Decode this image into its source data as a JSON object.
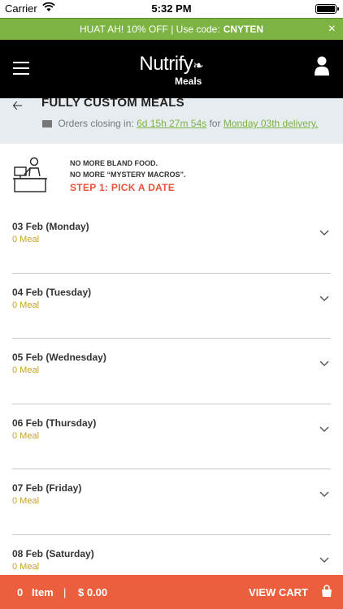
{
  "status_bar": {
    "carrier": "Carrier",
    "time": "5:32 PM"
  },
  "promo": {
    "text": "HUAT AH! 10% OFF | Use code:",
    "code": "CNYTEN",
    "close": "×"
  },
  "header": {
    "brand": "Nutrify",
    "sub": "Meals"
  },
  "page": {
    "title": "FULLY CUSTOM MEALS",
    "orders_prefix": "Orders closing in:",
    "countdown": "6d 15h 27m 54s",
    "for_text": "for",
    "delivery": "Monday 03th delivery."
  },
  "intro": {
    "line1": "NO MORE BLAND FOOD.",
    "line2": "NO MORE “MYSTERY MACROS”.",
    "step": "STEP 1: PICK A DATE"
  },
  "days": [
    {
      "name": "03 Feb (Monday)",
      "count": "0 Meal"
    },
    {
      "name": "04 Feb (Tuesday)",
      "count": "0 Meal"
    },
    {
      "name": "05 Feb (Wednesday)",
      "count": "0 Meal"
    },
    {
      "name": "06 Feb (Thursday)",
      "count": "0 Meal"
    },
    {
      "name": "07 Feb (Friday)",
      "count": "0 Meal"
    },
    {
      "name": "08 Feb (Saturday)",
      "count": "0 Meal"
    }
  ],
  "cart": {
    "count": "0",
    "item_label": "Item",
    "separator": "|",
    "amount": "$ 0.00",
    "view_label": "VIEW CART"
  },
  "colors": {
    "promo": "#7cb342",
    "accent": "#ec5f3e",
    "meal_count": "#c9a21e"
  }
}
